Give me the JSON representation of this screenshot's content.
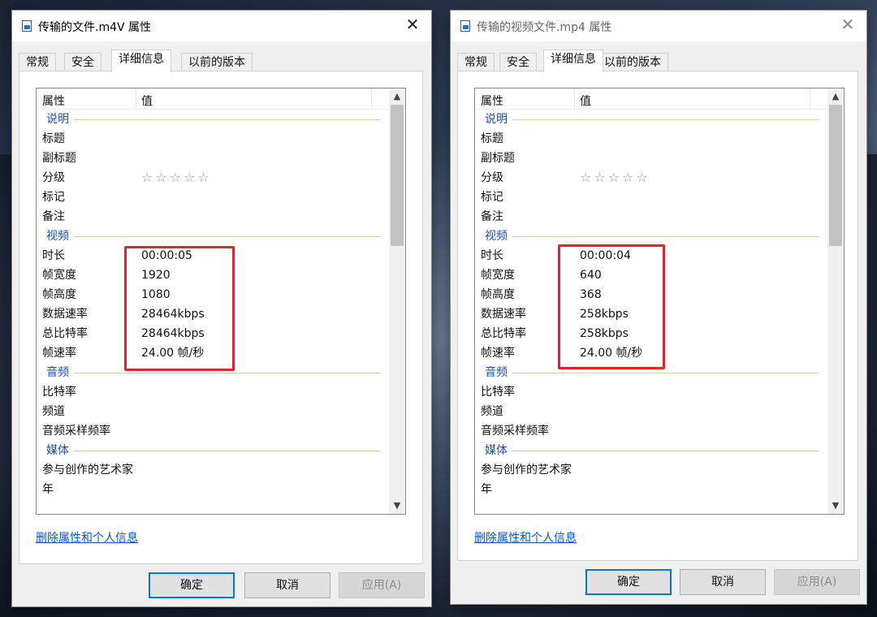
{
  "colors": {
    "highlight_border": "#e0232e",
    "group_heading": "#1e4fb0",
    "link": "#0a56c8",
    "primary_button_border": "#0078d7"
  },
  "dialogs": [
    {
      "title": "传输的文件.m4V 属性",
      "close_label": "✕",
      "tabs": [
        "常规",
        "安全",
        "详细信息",
        "以前的版本"
      ],
      "active_tab": "详细信息",
      "columns": {
        "property": "属性",
        "value": "值"
      },
      "rows": [
        {
          "group": "说明"
        },
        {
          "key": "标题",
          "value": ""
        },
        {
          "key": "副标题",
          "value": ""
        },
        {
          "key": "分级",
          "value": "☆☆☆☆☆",
          "stars": true
        },
        {
          "key": "标记",
          "value": ""
        },
        {
          "key": "备注",
          "value": ""
        },
        {
          "group": "视频"
        },
        {
          "key": "时长",
          "value": "00:00:05"
        },
        {
          "key": "帧宽度",
          "value": "1920"
        },
        {
          "key": "帧高度",
          "value": "1080"
        },
        {
          "key": "数据速率",
          "value": "28464kbps"
        },
        {
          "key": "总比特率",
          "value": "28464kbps"
        },
        {
          "key": "帧速率",
          "value": "24.00 帧/秒"
        },
        {
          "group": "音频"
        },
        {
          "key": "比特率",
          "value": ""
        },
        {
          "key": "频道",
          "value": ""
        },
        {
          "key": "音频采样频率",
          "value": ""
        },
        {
          "group": "媒体"
        },
        {
          "key": "参与创作的艺术家",
          "value": ""
        },
        {
          "key": "年",
          "value": ""
        }
      ],
      "remove_link": "删除属性和个人信息",
      "buttons": {
        "ok": "确定",
        "cancel": "取消",
        "apply": "应用(A)"
      }
    },
    {
      "title": "传输的视频文件.mp4 属性",
      "close_label": "✕",
      "tabs": [
        "常规",
        "安全",
        "详细信息",
        "以前的版本"
      ],
      "active_tab": "详细信息",
      "columns": {
        "property": "属性",
        "value": "值"
      },
      "rows": [
        {
          "group": "说明"
        },
        {
          "key": "标题",
          "value": ""
        },
        {
          "key": "副标题",
          "value": ""
        },
        {
          "key": "分级",
          "value": "☆☆☆☆☆",
          "stars": true
        },
        {
          "key": "标记",
          "value": ""
        },
        {
          "key": "备注",
          "value": ""
        },
        {
          "group": "视频"
        },
        {
          "key": "时长",
          "value": "00:00:04"
        },
        {
          "key": "帧宽度",
          "value": "640"
        },
        {
          "key": "帧高度",
          "value": "368"
        },
        {
          "key": "数据速率",
          "value": "258kbps"
        },
        {
          "key": "总比特率",
          "value": "258kbps"
        },
        {
          "key": "帧速率",
          "value": "24.00 帧/秒"
        },
        {
          "group": "音频"
        },
        {
          "key": "比特率",
          "value": ""
        },
        {
          "key": "频道",
          "value": ""
        },
        {
          "key": "音频采样频率",
          "value": ""
        },
        {
          "group": "媒体"
        },
        {
          "key": "参与创作的艺术家",
          "value": ""
        },
        {
          "key": "年",
          "value": ""
        }
      ],
      "remove_link": "删除属性和个人信息",
      "buttons": {
        "ok": "确定",
        "cancel": "取消",
        "apply": "应用(A)"
      }
    }
  ]
}
